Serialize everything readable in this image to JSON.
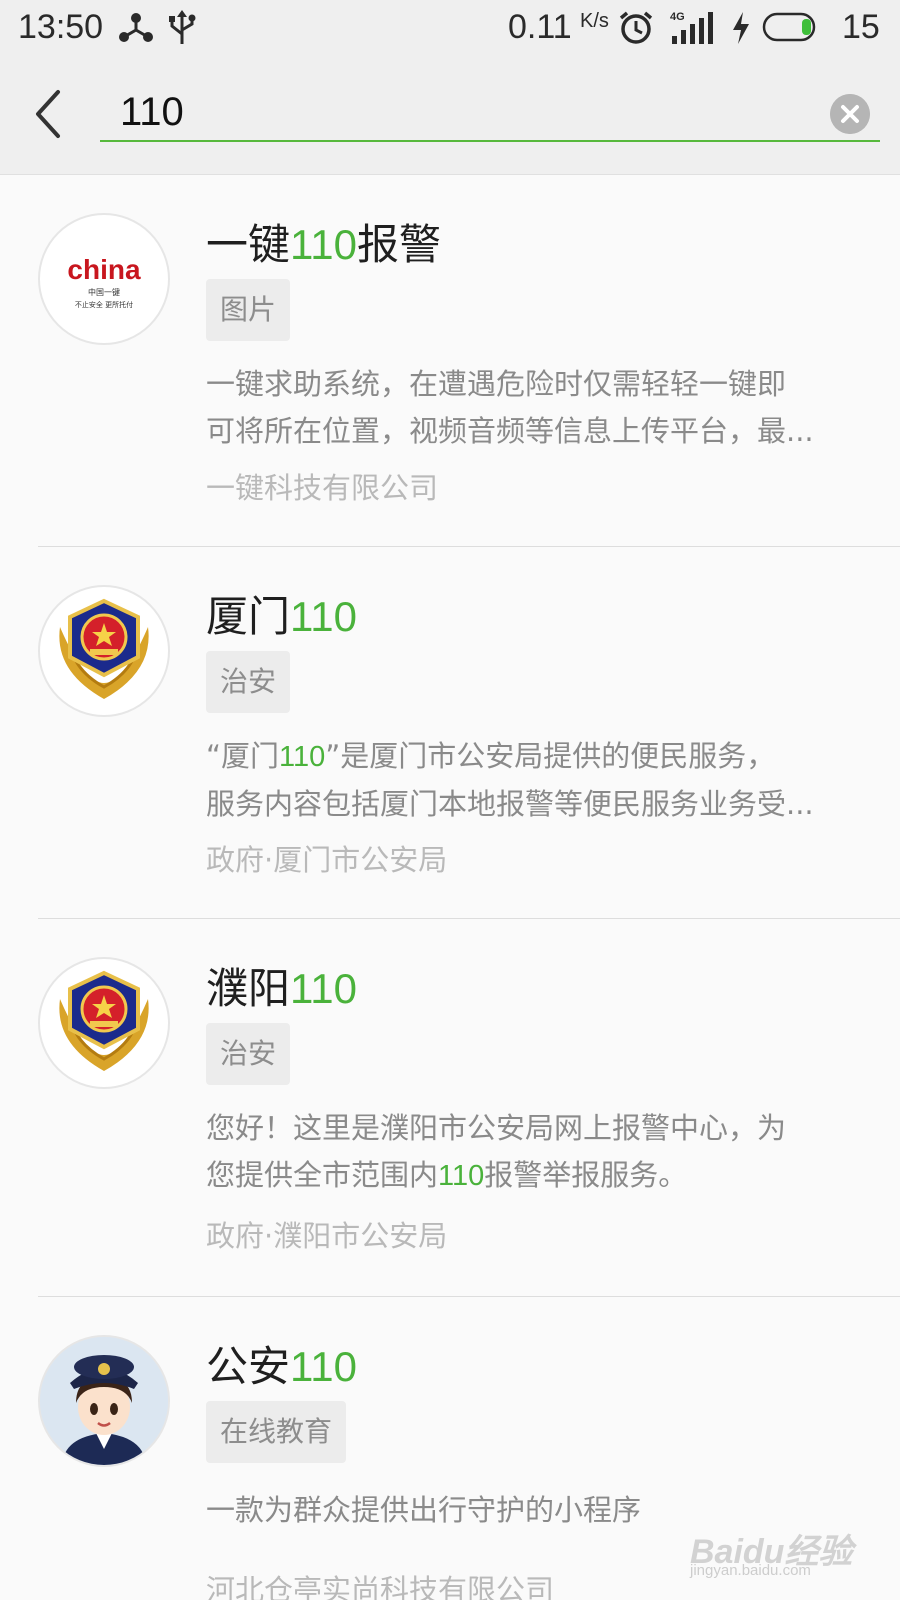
{
  "status_bar": {
    "time": "13:50",
    "net_speed": "0.11",
    "net_speed_unit": "K/s",
    "network_type": "4G",
    "battery": "15",
    "icons": [
      "share-icon",
      "usb-icon",
      "alarm-icon",
      "signal-icon",
      "charging-icon",
      "battery-icon"
    ]
  },
  "search": {
    "query": "110",
    "back_icon": "chevron-left-icon",
    "clear_icon": "clear-icon"
  },
  "results": [
    {
      "title_prefix": "一键",
      "title_highlight": "110",
      "title_suffix": "报警",
      "tag": "图片",
      "desc_line1": "一键求助系统，在遭遇危险时仅需轻轻一键即",
      "desc_line2": "可将所在位置，视频音频等信息上传平台，最...",
      "source": "一键科技有限公司",
      "avatar": {
        "icon": "china-logo-icon",
        "text": "china",
        "sub1": "中国一键",
        "sub2": "不止安全 更所托付"
      }
    },
    {
      "title_prefix": "厦门",
      "title_highlight": "110",
      "title_suffix": "",
      "tag": "治安",
      "desc_line1_a": "“厦门",
      "desc_line1_hl": "110",
      "desc_line1_b": "”是厦门市公安局提供的便民服务，",
      "desc_line2": "服务内容包括厦门本地报警等便民服务业务受...",
      "source": "政府·厦门市公安局",
      "avatar": {
        "icon": "police-emblem-icon"
      }
    },
    {
      "title_prefix": "濮阳",
      "title_highlight": "110",
      "title_suffix": "",
      "tag": "治安",
      "desc_line1": "您好！这里是濮阳市公安局网上报警中心，为",
      "desc_line2_a": "您提供全市范围内",
      "desc_line2_hl": "110",
      "desc_line2_b": "报警举报服务。",
      "source": "政府·濮阳市公安局",
      "avatar": {
        "icon": "police-emblem-icon"
      }
    },
    {
      "title_prefix": "公安",
      "title_highlight": "110",
      "title_suffix": "",
      "tag": "在线教育",
      "desc_line1": "一款为群众提供出行守护的小程序",
      "source": "河北仓亭实尚科技有限公司",
      "avatar": {
        "icon": "police-officer-cartoon-icon"
      }
    }
  ],
  "watermark": {
    "text": "Baidu经验",
    "url": "jingyan.baidu.com"
  },
  "colors": {
    "accent": "#4ab23b",
    "background": "#fafafa",
    "bar": "#efefef"
  }
}
